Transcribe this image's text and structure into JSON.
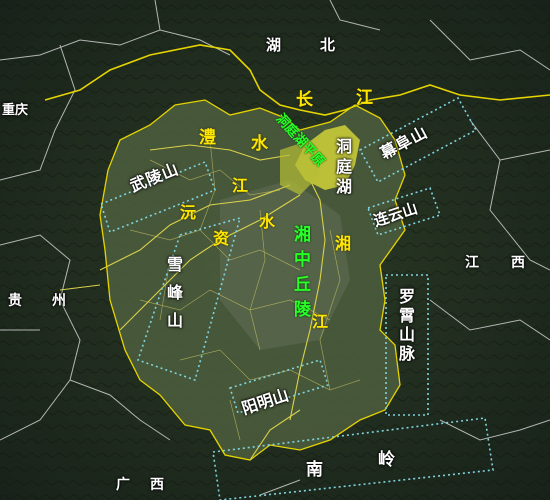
{
  "map": {
    "neighbors": {
      "hubei_1": "湖",
      "hubei_2": "北",
      "chongqing": "重庆",
      "guizhou_1": "贵",
      "guizhou_2": "州",
      "jiangxi_1": "江",
      "jiangxi_2": "西",
      "guangxi_1": "广",
      "guangxi_2": "西"
    },
    "rivers": {
      "changjiang_1": "长",
      "changjiang_2": "江",
      "li_1": "澧",
      "li_2": "水",
      "yuan_1": "沅",
      "yuan_2": "江",
      "zi_1": "资",
      "zi_2": "水",
      "xiang_1": "湘",
      "xiang_2": "江"
    },
    "regions": {
      "dongting_lake": "洞庭湖",
      "dongting_plain": "洞庭湖平原",
      "xiangzhong_hills": "湘中丘陵"
    },
    "mountains": {
      "wuling": "武陵山",
      "mufu": "幕阜山",
      "lianyun": "连云山",
      "xuefeng": "雪峰山",
      "luoxiao": "罗霄山脉",
      "yangming": "阳明山",
      "nanling_1": "南",
      "nanling_2": "岭"
    },
    "colors": {
      "background": "#1f2a1c",
      "province_fill": "#4d5e3e",
      "boundary": "#e5d400",
      "river": "#d9d24a",
      "mountain_box": "#7fd4e0",
      "county_line": "#e8e8e8"
    }
  }
}
